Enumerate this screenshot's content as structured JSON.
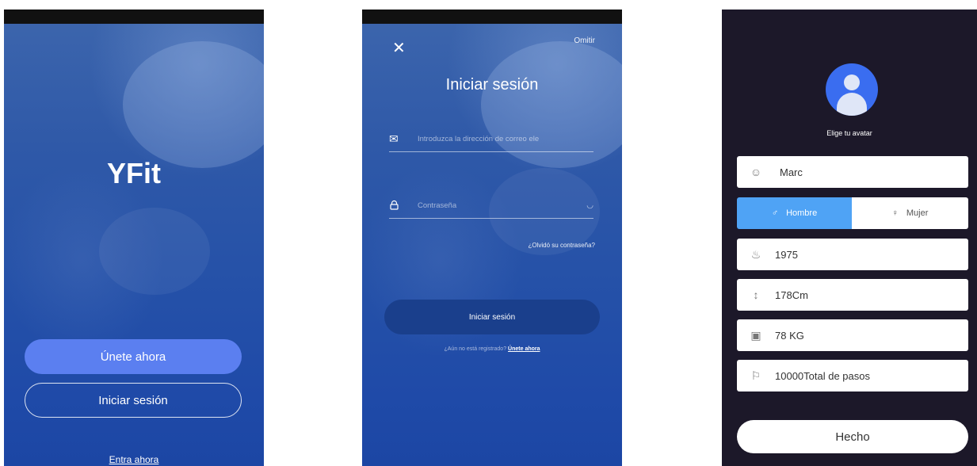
{
  "screen_welcome": {
    "app_title": "YFit",
    "join_label": "Únete ahora",
    "login_label": "Iniciar sesión",
    "enter_label": "Entra ahora",
    "colors": {
      "join_button": "#5b7ff0",
      "background": "#2551a8"
    }
  },
  "screen_login": {
    "close_icon": "close-icon",
    "skip_label": "Omitir",
    "title": "Iniciar sesión",
    "email_placeholder": "Introduzca la dirección de correo ele",
    "password_placeholder": "Contraseña",
    "forgot_label": "¿Olvidó su contraseña?",
    "submit_label": "Iniciar sesión",
    "register_prefix": "¿Aún no está registrado?",
    "register_link": "Únete ahora",
    "colors": {
      "submit_button": "#1a3f8c"
    }
  },
  "screen_profile": {
    "avatar_label": "Elige tu avatar",
    "name": "Marc",
    "gender_male": "Hombre",
    "gender_female": "Mujer",
    "selected_gender": "Hombre",
    "birth_year": "1975",
    "height": "178Cm",
    "weight": "78 KG",
    "steps_goal": "10000Total de pasos",
    "done_label": "Hecho",
    "colors": {
      "background": "#1c1829",
      "gender_selected": "#4fa3f5",
      "avatar": "#3a6df0"
    }
  }
}
